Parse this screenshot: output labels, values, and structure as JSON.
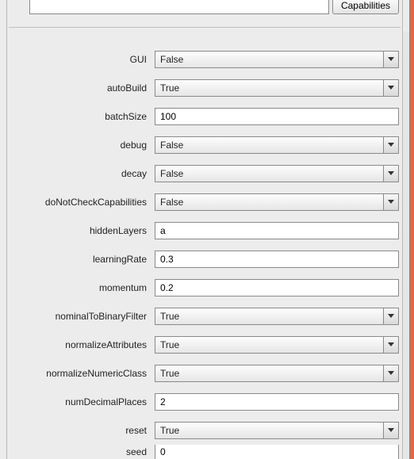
{
  "top": {
    "command_value": "",
    "capabilities_label": "Capabilities"
  },
  "options": [
    {
      "name": "GUI",
      "label": "GUI",
      "type": "combo",
      "value": "False"
    },
    {
      "name": "autoBuild",
      "label": "autoBuild",
      "type": "combo",
      "value": "True"
    },
    {
      "name": "batchSize",
      "label": "batchSize",
      "type": "text",
      "value": "100"
    },
    {
      "name": "debug",
      "label": "debug",
      "type": "combo",
      "value": "False"
    },
    {
      "name": "decay",
      "label": "decay",
      "type": "combo",
      "value": "False"
    },
    {
      "name": "doNotCheckCapabilities",
      "label": "doNotCheckCapabilities",
      "type": "combo",
      "value": "False"
    },
    {
      "name": "hiddenLayers",
      "label": "hiddenLayers",
      "type": "text",
      "value": "a"
    },
    {
      "name": "learningRate",
      "label": "learningRate",
      "type": "text",
      "value": "0.3"
    },
    {
      "name": "momentum",
      "label": "momentum",
      "type": "text",
      "value": "0.2"
    },
    {
      "name": "nominalToBinaryFilter",
      "label": "nominalToBinaryFilter",
      "type": "combo",
      "value": "True"
    },
    {
      "name": "normalizeAttributes",
      "label": "normalizeAttributes",
      "type": "combo",
      "value": "True"
    },
    {
      "name": "normalizeNumericClass",
      "label": "normalizeNumericClass",
      "type": "combo",
      "value": "True"
    },
    {
      "name": "numDecimalPlaces",
      "label": "numDecimalPlaces",
      "type": "text",
      "value": "2"
    },
    {
      "name": "reset",
      "label": "reset",
      "type": "combo",
      "value": "True"
    },
    {
      "name": "seed",
      "label": "seed",
      "type": "text",
      "value": "0"
    }
  ]
}
